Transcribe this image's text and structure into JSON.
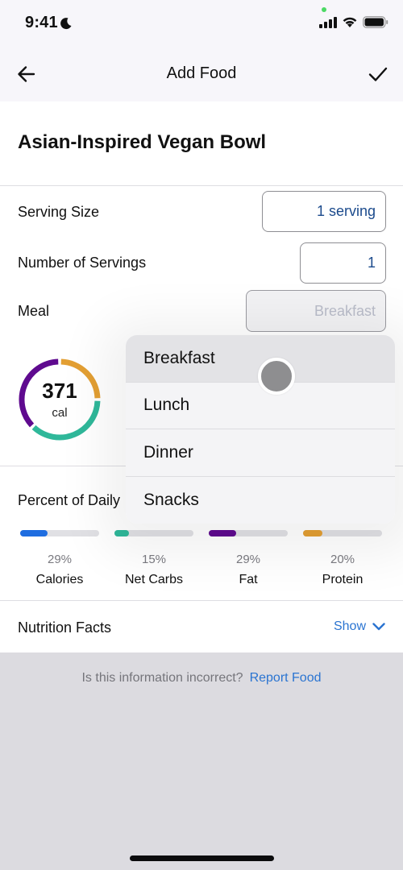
{
  "status_bar": {
    "time": "9:41",
    "focus_icon": "moon-icon",
    "icons": [
      "cellular-signal-icon",
      "wifi-icon",
      "battery-icon"
    ]
  },
  "nav": {
    "title": "Add Food",
    "back_icon": "arrow-left-icon",
    "confirm_icon": "checkmark-icon"
  },
  "food": {
    "name": "Asian-Inspired Vegan Bowl"
  },
  "form": {
    "serving_size": {
      "label": "Serving Size",
      "value": "1 serving"
    },
    "number_of_servings": {
      "label": "Number of Servings",
      "value": "1"
    },
    "meal": {
      "label": "Meal",
      "value": "Breakfast"
    }
  },
  "calories": {
    "value": "371",
    "unit": "cal",
    "ring_segments": [
      {
        "name": "protein",
        "fraction": 0.25,
        "color": "#e39f33"
      },
      {
        "name": "carbs",
        "fraction": 0.375,
        "color": "#2fb89a"
      },
      {
        "name": "fat",
        "fraction": 0.375,
        "color": "#5f0a8f"
      }
    ]
  },
  "percent_daily": {
    "label": "Percent of Daily",
    "macros": [
      {
        "name": "Calories",
        "percent_text": "29%",
        "percent": 29,
        "color": "#1f6de0"
      },
      {
        "name": "Net Carbs",
        "percent_text": "15%",
        "percent": 15,
        "color": "#2fb89a"
      },
      {
        "name": "Fat",
        "percent_text": "29%",
        "percent": 29,
        "color": "#5f0a8f"
      },
      {
        "name": "Protein",
        "percent_text": "20%",
        "percent": 20,
        "color": "#e39f33"
      }
    ]
  },
  "nutrition_facts": {
    "label": "Nutrition Facts",
    "toggle_label": "Show",
    "toggle_icon": "chevron-down-icon"
  },
  "report": {
    "prompt": "Is this information incorrect?",
    "link": "Report Food"
  },
  "meal_menu": {
    "options": [
      "Breakfast",
      "Lunch",
      "Dinner",
      "Snacks"
    ],
    "highlighted": "Breakfast"
  },
  "colors": {
    "accent_blue": "#2a74d1",
    "field_value_blue": "#1b4a8c"
  }
}
